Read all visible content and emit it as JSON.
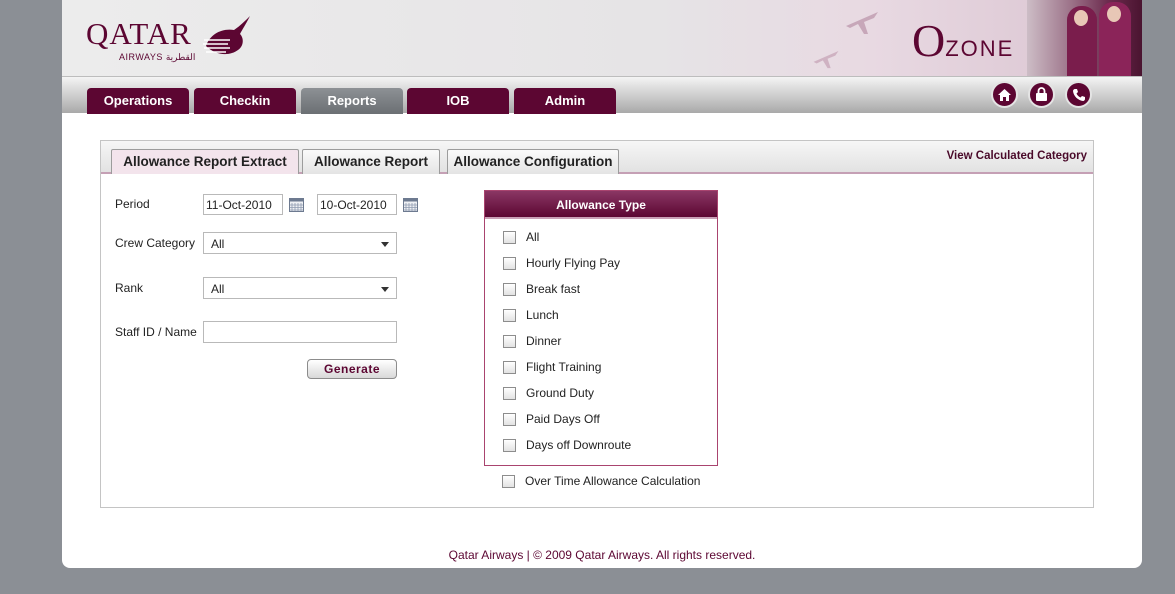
{
  "brand": {
    "logo_text": "QATAR",
    "logo_sub": "AIRWAYS القطرية",
    "app_first_letter": "O",
    "app_rest": "ZONE"
  },
  "nav": {
    "tabs": [
      {
        "label": "Operations"
      },
      {
        "label": "Checkin"
      },
      {
        "label": "Reports"
      },
      {
        "label": "IOB"
      },
      {
        "label": "Admin"
      }
    ],
    "active": "Reports",
    "icons": [
      "home-icon",
      "lock-icon",
      "phone-icon"
    ]
  },
  "subtabs": [
    {
      "label": "Allowance Report Extract"
    },
    {
      "label": "Allowance Report"
    },
    {
      "label": "Allowance Configuration"
    }
  ],
  "view_link": "View Calculated Category",
  "form": {
    "period_label": "Period",
    "period_from": "11-Oct-2010",
    "period_to": "10-Oct-2010",
    "crew_category_label": "Crew Category",
    "crew_category_value": "All",
    "rank_label": "Rank",
    "rank_value": "All",
    "staff_label": "Staff ID / Name",
    "staff_value": "",
    "generate_label": "Generate"
  },
  "allowance": {
    "title": "Allowance Type",
    "items": [
      {
        "label": "All"
      },
      {
        "label": "Hourly Flying Pay"
      },
      {
        "label": "Break fast"
      },
      {
        "label": "Lunch"
      },
      {
        "label": "Dinner"
      },
      {
        "label": "Flight Training"
      },
      {
        "label": "Ground Duty"
      },
      {
        "label": "Paid Days Off"
      },
      {
        "label": "Days off Downroute"
      }
    ],
    "overtime_label": "Over Time Allowance Calculation"
  },
  "footer": "Qatar Airways | © 2009 Qatar Airways. All rights reserved.",
  "colors": {
    "brand": "#5c0632",
    "background": "#8b8f95",
    "active_tab": "#6b6f73"
  }
}
